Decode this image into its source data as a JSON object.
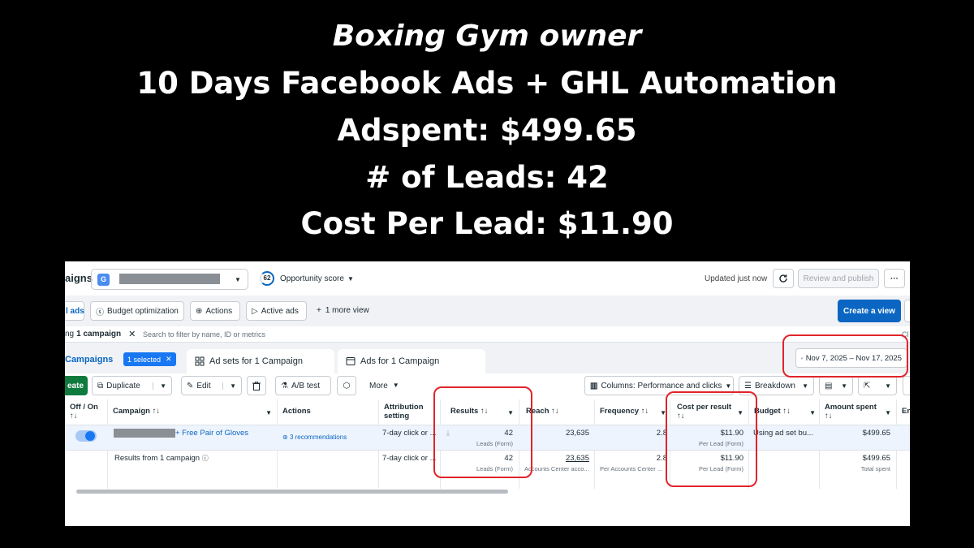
{
  "headline": {
    "line1": "Boxing Gym owner",
    "line2": "10 Days Facebook Ads + GHL Automation",
    "line3": "Adspent: $499.65",
    "line4": "# of Leads: 42",
    "line5": "Cost Per Lead: $11.90"
  },
  "topbar": {
    "page_title": "aigns",
    "account_initial": "G",
    "opportunity_value": "62",
    "opportunity_label": "Opportunity score",
    "updated": "Updated just now",
    "review_publish": "Review and publish",
    "more": "···"
  },
  "toolbar": {
    "ads_tab": "l ads",
    "budget_optimization": "Budget optimization",
    "actions": "Actions",
    "active_ads": "Active ads",
    "more_view": "1 more view",
    "create_view": "Create a view"
  },
  "filter": {
    "chip_prefix": "ng",
    "chip_label": "1 campaign",
    "placeholder": "Search to filter by name, ID or metrics",
    "cut": "Cl"
  },
  "tabs": {
    "campaigns": "Campaigns",
    "selected": "1 selected",
    "ad_sets": "Ad sets for 1 Campaign",
    "ads": "Ads for 1 Campaign",
    "date_range": "Nov 7, 2025 – Nov 17, 2025"
  },
  "actions_bar": {
    "create": "eate",
    "duplicate": "Duplicate",
    "edit": "Edit",
    "ab_test": "A/B test",
    "more": "More",
    "columns": "Columns: Performance and clicks",
    "breakdown": "Breakdown"
  },
  "table": {
    "headers": {
      "offon": "Off / On",
      "campaign": "Campaign",
      "actions": "Actions",
      "attribution_1": "Attribution",
      "attribution_2": "setting",
      "results": "Results",
      "reach": "Reach",
      "frequency": "Frequency",
      "cost_per_result": "Cost per result",
      "budget": "Budget",
      "amount_spent": "Amount spent",
      "ends": "En"
    },
    "sort_glyph": "↑↓",
    "row1": {
      "campaign_suffix": "+ Free Pair of Gloves",
      "recommendations": "3 recommendations",
      "attribution": "7-day click or ...",
      "results": "42",
      "results_sub": "Leads (Form)",
      "reach": "23,635",
      "frequency": "2.8",
      "cost": "$11.90",
      "cost_sub": "Per Lead (Form)",
      "budget": "Using ad set bu...",
      "spent": "$499.65"
    },
    "row2": {
      "label": "Results from 1 campaign",
      "attribution": "7-day click or ...",
      "results": "42",
      "results_sub": "Leads (Form)",
      "reach": "23,635",
      "reach_sub": "Accounts Center acco...",
      "frequency": "2.8",
      "frequency_sub": "Per Accounts Center ...",
      "cost": "$11.90",
      "cost_sub": "Per Lead (Form)",
      "spent": "$499.65",
      "spent_sub": "Total spent"
    }
  },
  "colors": {
    "accent": "#0a66c2",
    "highlight": "#e0242b",
    "toggle": "#1877f2"
  }
}
